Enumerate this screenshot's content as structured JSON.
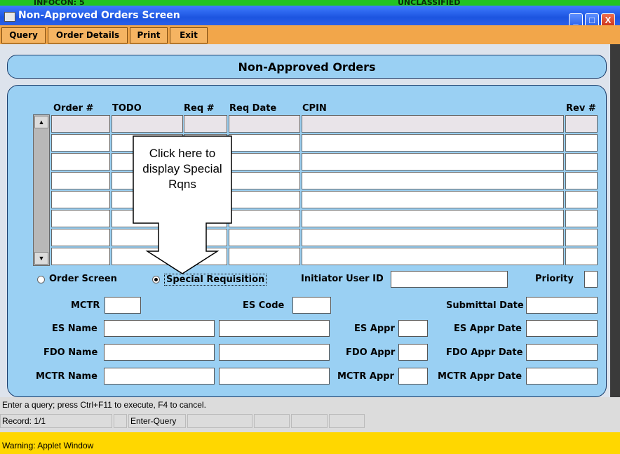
{
  "banner": {
    "left": "INFOCON: 5",
    "center": "UNCLASSIFIED"
  },
  "window": {
    "title": "Non-Approved Orders Screen",
    "minimize": "_",
    "maximize": "□",
    "close": "X"
  },
  "menu": {
    "query": "Query",
    "order_details": "Order Details",
    "print": "Print",
    "exit": "Exit"
  },
  "header": {
    "title": "Non-Approved Orders"
  },
  "table": {
    "columns": [
      "Order #",
      "TODO",
      "Req #",
      "Req Date",
      "CPIN",
      "Rev #"
    ],
    "rows": [
      [
        "",
        "",
        "",
        "",
        "",
        ""
      ],
      [
        "",
        "",
        "",
        "",
        "",
        ""
      ],
      [
        "",
        "",
        "",
        "",
        "",
        ""
      ],
      [
        "",
        "",
        "",
        "",
        "",
        ""
      ],
      [
        "",
        "",
        "",
        "",
        "",
        ""
      ],
      [
        "",
        "",
        "",
        "",
        "",
        ""
      ],
      [
        "",
        "",
        "",
        "",
        "",
        ""
      ],
      [
        "",
        "",
        "",
        "",
        "",
        ""
      ]
    ]
  },
  "callout": {
    "text": "Click here to display Special Rqns"
  },
  "radios": {
    "order_screen": "Order Screen",
    "special_requisition": "Special Requisition",
    "selected": "special_requisition"
  },
  "fields": {
    "initiator_user_id": {
      "label": "Initiator User ID",
      "value": ""
    },
    "priority": {
      "label": "Priority",
      "value": ""
    },
    "mctr": {
      "label": "MCTR",
      "value": ""
    },
    "es_code": {
      "label": "ES Code",
      "value": ""
    },
    "submittal_date": {
      "label": "Submittal Date",
      "value": ""
    },
    "es_name": {
      "label": "ES Name",
      "value1": "",
      "value2": ""
    },
    "es_appr": {
      "label": "ES Appr",
      "value": ""
    },
    "es_appr_date": {
      "label": "ES Appr Date",
      "value": ""
    },
    "fdo_name": {
      "label": "FDO Name",
      "value1": "",
      "value2": ""
    },
    "fdo_appr": {
      "label": "FDO Appr",
      "value": ""
    },
    "fdo_appr_date": {
      "label": "FDO Appr Date",
      "value": ""
    },
    "mctr_name": {
      "label": "MCTR Name",
      "value1": "",
      "value2": ""
    },
    "mctr_appr": {
      "label": "MCTR Appr",
      "value": ""
    },
    "mctr_appr_date": {
      "label": "MCTR Appr Date",
      "value": ""
    }
  },
  "status": {
    "hint": "Enter a query;  press Ctrl+F11 to execute, F4 to cancel.",
    "record": "Record: 1/1",
    "mode": "Enter-Query"
  },
  "warning": "Warning: Applet Window",
  "colors": {
    "banner": "#22c322",
    "titlebar": "#1c54e0",
    "menubar": "#f2a64a",
    "panel": "#9ad0f3",
    "warning": "#ffd700"
  }
}
